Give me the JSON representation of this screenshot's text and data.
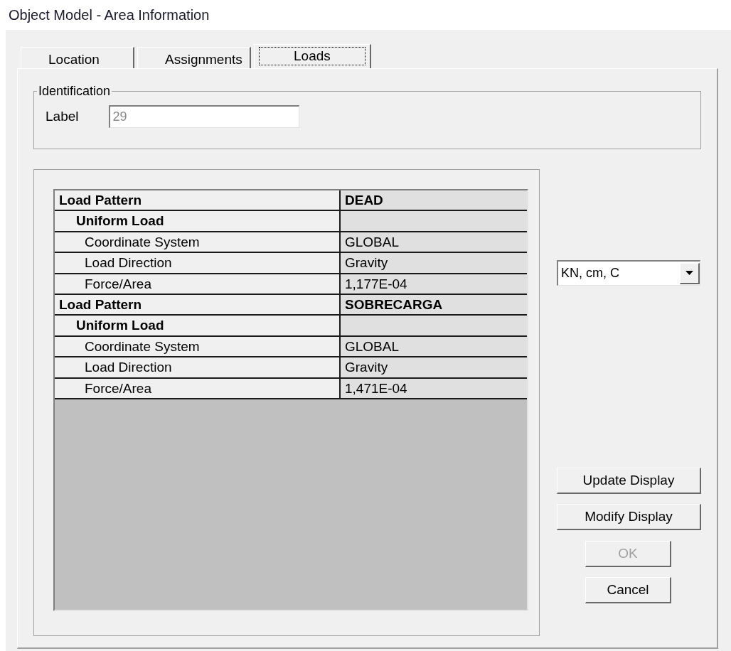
{
  "window": {
    "title": "Object Model - Area Information"
  },
  "tabs": [
    {
      "label": "Location",
      "selected": false
    },
    {
      "label": "Assignments",
      "selected": false
    },
    {
      "label": "Loads",
      "selected": true
    }
  ],
  "identification": {
    "title": "Identification",
    "caption": "Label",
    "value": "29",
    "disabled": true
  },
  "grid": {
    "rows": [
      {
        "kind": "pattern",
        "name": "Load Pattern",
        "value": "DEAD"
      },
      {
        "kind": "section",
        "name": "Uniform Load"
      },
      {
        "kind": "property",
        "name": "Coordinate System",
        "value": "GLOBAL"
      },
      {
        "kind": "property",
        "name": "Load Direction",
        "value": "Gravity"
      },
      {
        "kind": "property",
        "name": "Force/Area",
        "value": "1,177E-04"
      },
      {
        "kind": "pattern",
        "name": "Load Pattern",
        "value": "SOBRECARGA"
      },
      {
        "kind": "section",
        "name": "Uniform Load"
      },
      {
        "kind": "property",
        "name": "Coordinate System",
        "value": "GLOBAL"
      },
      {
        "kind": "property",
        "name": "Load Direction",
        "value": "Gravity"
      },
      {
        "kind": "property",
        "name": "Force/Area",
        "value": "1,471E-04"
      }
    ]
  },
  "units": {
    "value": "KN, cm, C"
  },
  "display_buttons": [
    {
      "label": "Update Display",
      "disabled": false
    },
    {
      "label": "Modify Display",
      "disabled": false
    }
  ],
  "dialog_buttons": [
    {
      "label": "OK",
      "disabled": true
    },
    {
      "label": "Cancel",
      "disabled": false
    }
  ]
}
